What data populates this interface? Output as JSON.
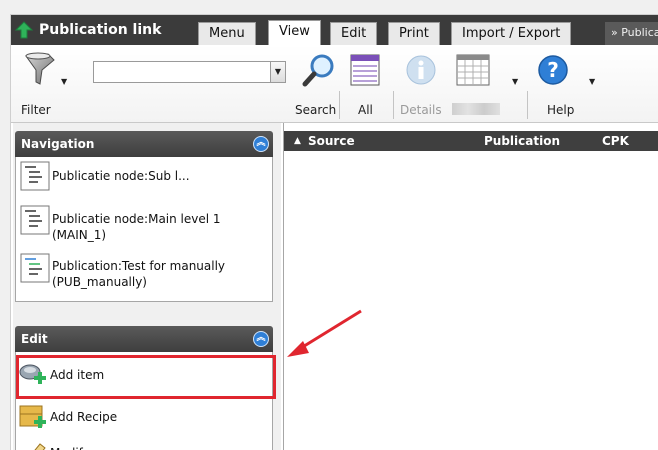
{
  "header": {
    "app_title": "Publication link",
    "tabs": [
      {
        "label": "Menu"
      },
      {
        "label": "View"
      },
      {
        "label": "Edit"
      },
      {
        "label": "Print"
      },
      {
        "label": "Import / Export"
      }
    ],
    "overflow_tab": "» Publica"
  },
  "ribbon": {
    "filter_label": "Filter",
    "search_input_value": "",
    "search_label": "Search",
    "all_label": "All",
    "details_label": "Details",
    "help_label": "Help"
  },
  "navigation": {
    "title": "Navigation",
    "items": [
      {
        "label": "Publicatie node:Sub l..."
      },
      {
        "label": "Publicatie node:Main level 1 (MAIN_1)"
      },
      {
        "label": "Publication:Test for manually (PUB_manually)"
      }
    ]
  },
  "edit_panel": {
    "title": "Edit",
    "items": [
      {
        "label": "Add item"
      },
      {
        "label": "Add Recipe"
      },
      {
        "label": "Modify"
      }
    ]
  },
  "grid": {
    "columns": [
      "Source",
      "Publication",
      "CPK"
    ],
    "sort_indicator": "▲"
  },
  "colors": {
    "header_bg": "#3b3b3b",
    "highlight": "#e0262f",
    "accent_blue": "#2f7fd6",
    "brand_green": "#2fb35a"
  }
}
